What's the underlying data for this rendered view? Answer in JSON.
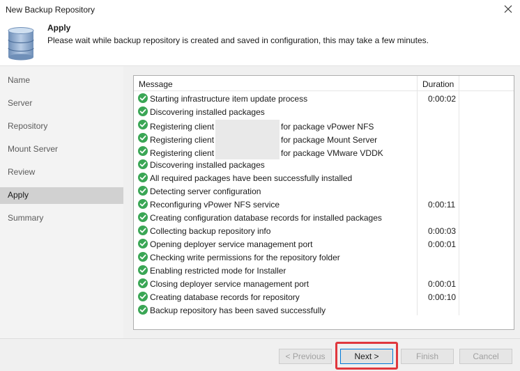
{
  "window": {
    "title": "New Backup Repository"
  },
  "header": {
    "step_title": "Apply",
    "step_description": "Please wait while backup repository is created and saved in configuration, this may take a few minutes."
  },
  "sidebar": {
    "items": [
      {
        "label": "Name",
        "active": false
      },
      {
        "label": "Server",
        "active": false
      },
      {
        "label": "Repository",
        "active": false
      },
      {
        "label": "Mount Server",
        "active": false
      },
      {
        "label": "Review",
        "active": false
      },
      {
        "label": "Apply",
        "active": true
      },
      {
        "label": "Summary",
        "active": false
      }
    ]
  },
  "log": {
    "columns": {
      "message": "Message",
      "duration": "Duration"
    },
    "rows": [
      {
        "message": "Starting infrastructure item update process",
        "duration": "0:00:02"
      },
      {
        "message": "Discovering installed packages",
        "duration": ""
      },
      {
        "prefix": "Registering client",
        "suffix": "for package vPower NFS",
        "duration": ""
      },
      {
        "prefix": "Registering client",
        "suffix": "for package Mount Server",
        "duration": ""
      },
      {
        "prefix": "Registering client",
        "suffix": "for package VMware VDDK",
        "duration": ""
      },
      {
        "message": "Discovering installed packages",
        "duration": ""
      },
      {
        "message": "All required packages have been successfully installed",
        "duration": ""
      },
      {
        "message": "Detecting server configuration",
        "duration": ""
      },
      {
        "message": "Reconfiguring vPower NFS service",
        "duration": "0:00:11"
      },
      {
        "message": "Creating configuration database records for installed packages",
        "duration": ""
      },
      {
        "message": "Collecting backup repository info",
        "duration": "0:00:03"
      },
      {
        "message": "Opening deployer service management port",
        "duration": "0:00:01"
      },
      {
        "message": "Checking write permissions for the repository folder",
        "duration": ""
      },
      {
        "message": "Enabling restricted mode for Installer",
        "duration": ""
      },
      {
        "message": "Closing deployer service management port",
        "duration": "0:00:01"
      },
      {
        "message": "Creating database records for repository",
        "duration": "0:00:10"
      },
      {
        "message": "Backup repository has been saved successfully",
        "duration": ""
      }
    ]
  },
  "footer": {
    "previous_label": "< Previous",
    "next_label": "Next >",
    "finish_label": "Finish",
    "cancel_label": "Cancel"
  },
  "colors": {
    "success": "#3aa655",
    "highlight": "#e0373d",
    "accent": "#0078d7"
  },
  "icons": {
    "header": "database-icon",
    "row_status": "success-check-icon",
    "close": "close-icon"
  }
}
